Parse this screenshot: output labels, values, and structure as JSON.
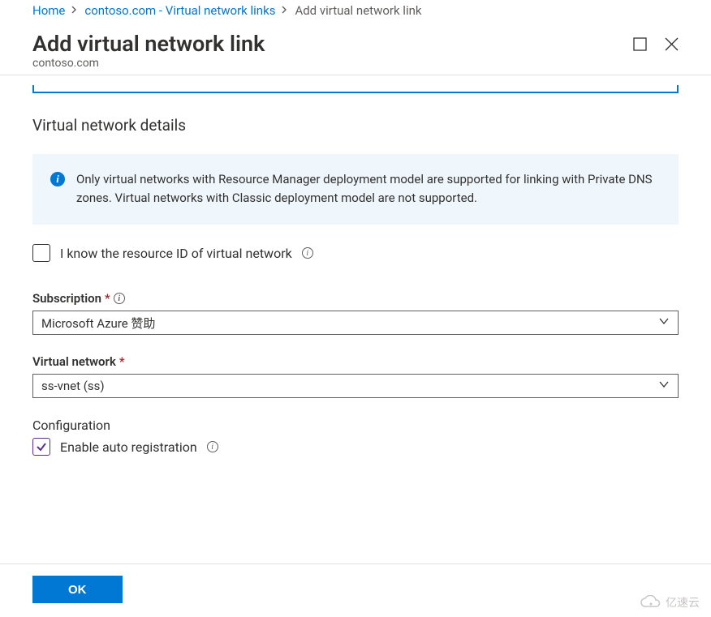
{
  "breadcrumb": {
    "home": "Home",
    "mid": "contoso.com - Virtual network links",
    "current": "Add virtual network link"
  },
  "header": {
    "title": "Add virtual network link",
    "subtitle": "contoso.com"
  },
  "section": {
    "details_title": "Virtual network details",
    "info_message": "Only virtual networks with Resource Manager deployment model are supported for linking with Private DNS zones. Virtual networks with Classic deployment model are not supported.",
    "know_resource_id": "I know the resource ID of virtual network"
  },
  "fields": {
    "subscription_label": "Subscription",
    "subscription_value": "Microsoft Azure 赞助",
    "vnet_label": "Virtual network",
    "vnet_value": "ss-vnet (ss)"
  },
  "config": {
    "title": "Configuration",
    "auto_reg": "Enable auto registration"
  },
  "footer": {
    "ok": "OK"
  },
  "watermark": {
    "text": "亿速云"
  }
}
